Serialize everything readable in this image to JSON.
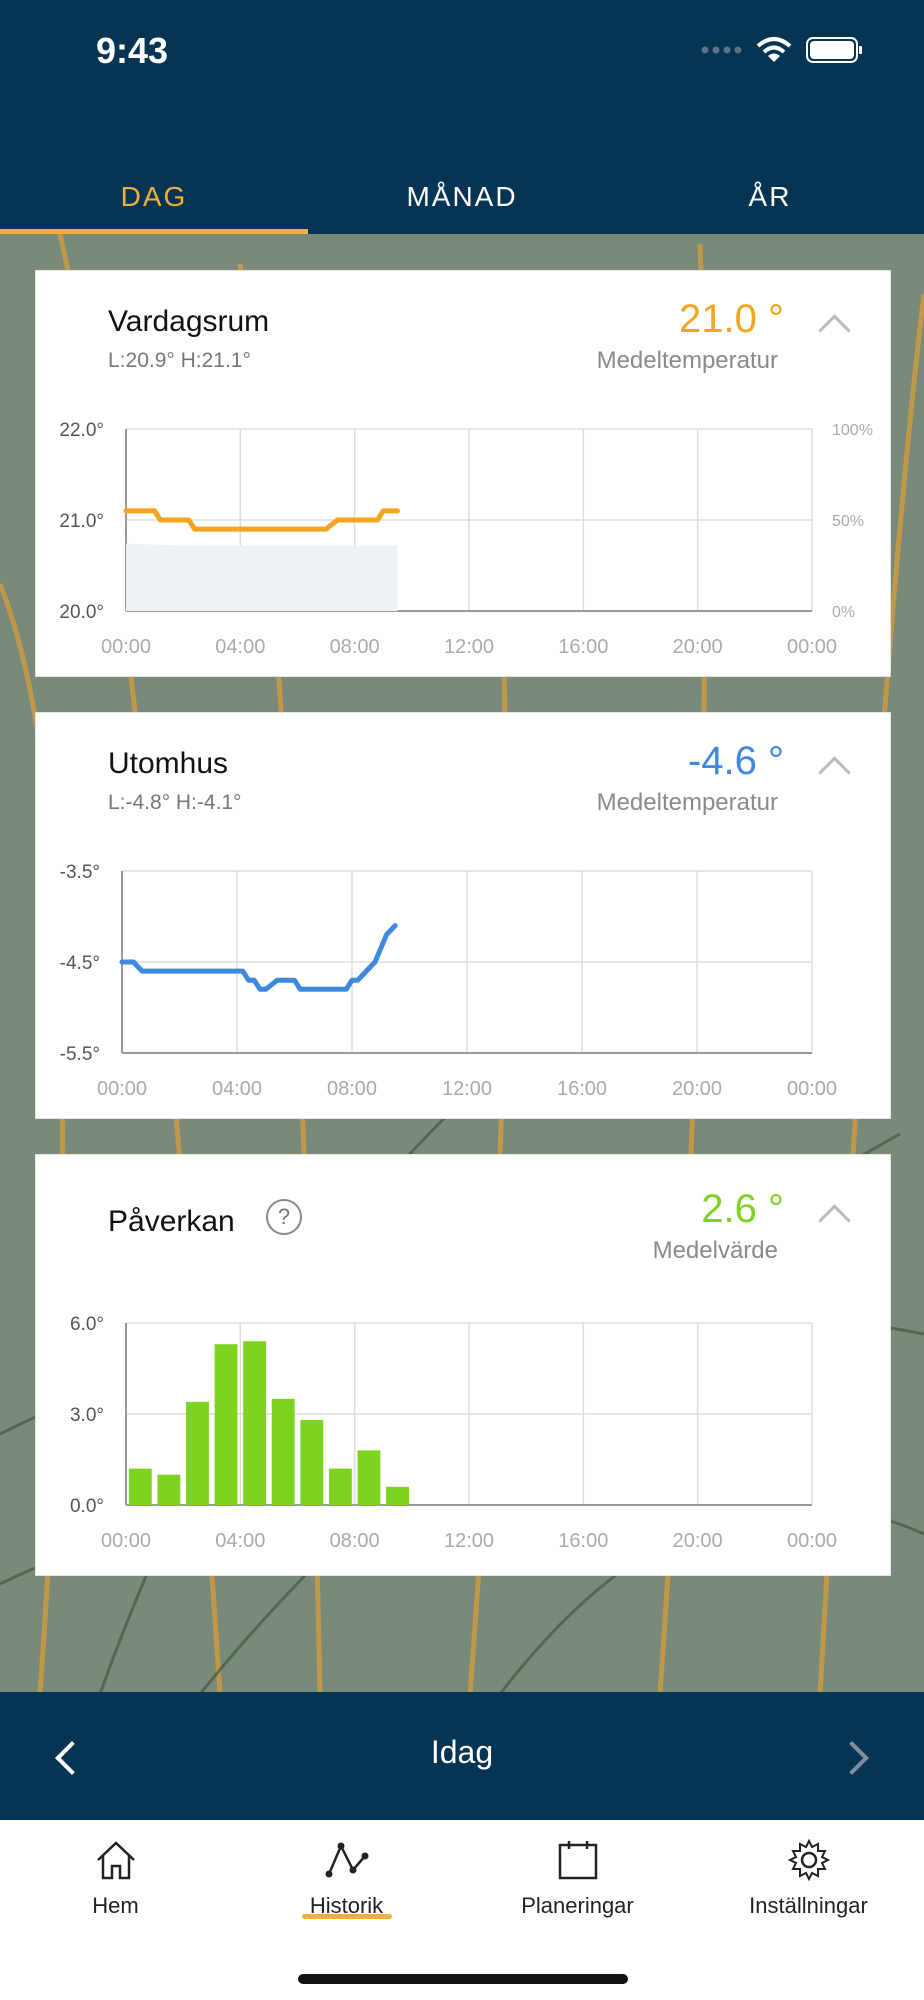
{
  "status": {
    "time": "9:43"
  },
  "tabs": [
    {
      "label": "DAG",
      "active": true
    },
    {
      "label": "MÅNAD",
      "active": false
    },
    {
      "label": "ÅR",
      "active": false
    }
  ],
  "cards": {
    "vardagsrum": {
      "title": "Vardagsrum",
      "sub": "L:20.9° H:21.1°",
      "value": "21.0 °",
      "caption": "Medeltemperatur",
      "color": "#f4a51e"
    },
    "utomhus": {
      "title": "Utomhus",
      "sub": "L:-4.8° H:-4.1°",
      "value": "-4.6 °",
      "caption": "Medeltemperatur",
      "color": "#3f88e0"
    },
    "paverkan": {
      "title": "Påverkan",
      "help": "?",
      "value": "2.6 °",
      "caption": "Medelvärde",
      "color": "#7ed321"
    }
  },
  "chart_data": [
    {
      "type": "line",
      "title": "Vardagsrum",
      "x_ticks": [
        "00:00",
        "04:00",
        "08:00",
        "12:00",
        "16:00",
        "20:00",
        "00:00"
      ],
      "y_ticks": [
        "22.0°",
        "21.0°",
        "20.0°"
      ],
      "y2_ticks": [
        "100%",
        "50%",
        "0%"
      ],
      "ylim": [
        20.0,
        22.0
      ],
      "y2lim": [
        0,
        100
      ],
      "series": [
        {
          "kind": "line",
          "color": "#f4a51e",
          "x": [
            0,
            0.4,
            1.0,
            1.2,
            1.6,
            2.2,
            2.4,
            3.0,
            4.0,
            5.0,
            6.0,
            6.8,
            7.0,
            7.4,
            8.0,
            8.4,
            8.8,
            9.0,
            9.5
          ],
          "y": [
            21.1,
            21.1,
            21.1,
            21.0,
            21.0,
            21.0,
            20.9,
            20.9,
            20.9,
            20.9,
            20.9,
            20.9,
            20.9,
            21.0,
            21.0,
            21.0,
            21.0,
            21.1,
            21.1
          ]
        },
        {
          "kind": "area",
          "axis": "y2",
          "color": "#eef2f7",
          "x": [
            0,
            2,
            4,
            6,
            8,
            9.5
          ],
          "y": [
            37,
            36,
            36,
            36,
            36,
            36
          ]
        }
      ]
    },
    {
      "type": "line",
      "title": "Utomhus",
      "x_ticks": [
        "00:00",
        "04:00",
        "08:00",
        "12:00",
        "16:00",
        "20:00",
        "00:00"
      ],
      "y_ticks": [
        "-3.5°",
        "-4.5°",
        "-5.5°"
      ],
      "ylim": [
        -5.5,
        -3.5
      ],
      "series": [
        {
          "kind": "line",
          "color": "#3f88e0",
          "x": [
            0,
            0.4,
            0.7,
            1.2,
            2.0,
            3.0,
            4.0,
            4.2,
            4.4,
            4.6,
            4.8,
            5.0,
            5.4,
            5.6,
            6.0,
            6.2,
            6.5,
            7.0,
            7.6,
            7.8,
            8.0,
            8.2,
            8.5,
            8.8,
            9.2,
            9.5
          ],
          "y": [
            -4.5,
            -4.5,
            -4.6,
            -4.6,
            -4.6,
            -4.6,
            -4.6,
            -4.6,
            -4.7,
            -4.7,
            -4.8,
            -4.8,
            -4.7,
            -4.7,
            -4.7,
            -4.8,
            -4.8,
            -4.8,
            -4.8,
            -4.8,
            -4.7,
            -4.7,
            -4.6,
            -4.5,
            -4.2,
            -4.1
          ]
        }
      ]
    },
    {
      "type": "bar",
      "title": "Påverkan",
      "x_ticks": [
        "00:00",
        "04:00",
        "08:00",
        "12:00",
        "16:00",
        "20:00",
        "00:00"
      ],
      "y_ticks": [
        "6.0°",
        "3.0°",
        "0.0°"
      ],
      "ylim": [
        0,
        6
      ],
      "categories": [
        "00:00",
        "01:00",
        "02:00",
        "03:00",
        "04:00",
        "05:00",
        "06:00",
        "07:00",
        "08:00",
        "09:00"
      ],
      "values": [
        1.2,
        1.0,
        3.4,
        5.3,
        5.4,
        3.5,
        2.8,
        1.2,
        1.8,
        0.6
      ],
      "color": "#7ed321"
    }
  ],
  "datebar": {
    "label": "Idag"
  },
  "bottom_nav": [
    {
      "label": "Hem",
      "icon": "home-icon",
      "active": false
    },
    {
      "label": "Historik",
      "icon": "history-icon",
      "active": true
    },
    {
      "label": "Planeringar",
      "icon": "calendar-icon",
      "active": false
    },
    {
      "label": "Inställningar",
      "icon": "gear-icon",
      "active": false
    }
  ]
}
